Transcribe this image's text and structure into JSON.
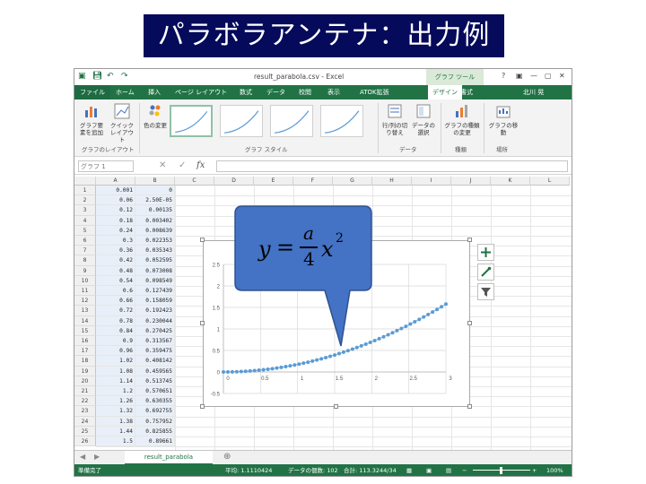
{
  "slide_title": "パラボラアンテナ：出力例",
  "excel": {
    "window_title": "result_parabola.csv - Excel",
    "context_tab": "グラフ ツール",
    "window_controls": [
      "?",
      "▣",
      "—",
      "▢",
      "✕"
    ],
    "tabs": [
      "ファイル",
      "ホーム",
      "挿入",
      "ページ レイアウト",
      "数式",
      "データ",
      "校閲",
      "表示",
      "ATOK拡張",
      "デザイン",
      "書式"
    ],
    "active_tab": "デザイン",
    "user": "北川 晃",
    "ribbon": {
      "buttons": [
        "グラフ要素を追加",
        "クイック レイアウト",
        "色の変更",
        "行/列の切り替え",
        "データの選択",
        "グラフの種類の変更",
        "グラフの移動"
      ],
      "groups": [
        "グラフのレイアウト",
        "グラフ スタイル",
        "データ",
        "種類",
        "場所"
      ]
    },
    "formula_bar": {
      "name_box": "グラフ 1",
      "fx": "fx"
    },
    "columns": [
      "A",
      "B",
      "C",
      "D",
      "E",
      "F",
      "G",
      "H",
      "I",
      "J",
      "K",
      "L"
    ],
    "rows": [
      "1",
      "2",
      "3",
      "4",
      "5",
      "6",
      "7",
      "8",
      "9",
      "10",
      "11",
      "12",
      "13",
      "14",
      "15",
      "16",
      "17",
      "18",
      "19",
      "20",
      "21",
      "22",
      "23",
      "24",
      "25",
      "26"
    ],
    "col_a": [
      "0.001",
      "0.06",
      "0.12",
      "0.18",
      "0.24",
      "0.3",
      "0.36",
      "0.42",
      "0.48",
      "0.54",
      "0.6",
      "0.66",
      "0.72",
      "0.78",
      "0.84",
      "0.9",
      "0.96",
      "1.02",
      "1.08",
      "1.14",
      "1.2",
      "1.26",
      "1.32",
      "1.38",
      "1.44",
      "1.5"
    ],
    "col_b": [
      "0",
      "2.50E-05",
      "0.00135",
      "0.003402",
      "0.008639",
      "0.022353",
      "0.035343",
      "0.052595",
      "0.073008",
      "0.098549",
      "0.127439",
      "0.158059",
      "0.192423",
      "0.230044",
      "0.270425",
      "0.313567",
      "0.359475",
      "0.408142",
      "0.459565",
      "0.513745",
      "0.570651",
      "0.630355",
      "0.692755",
      "0.757952",
      "0.825855",
      "0.89661"
    ],
    "sheet_tab": "result_parabola",
    "status": {
      "ready": "準備完了",
      "average": "平均: 1.1110424",
      "count": "データの個数: 102",
      "sum": "合計: 113.3244/34",
      "zoom": "100%"
    }
  },
  "callout": {
    "formula_lhs": "y",
    "equals": "=",
    "numerator": "a",
    "denominator": "4",
    "variable": "x",
    "exponent": "2"
  },
  "chart_data": {
    "type": "scatter",
    "title": "",
    "xlabel": "",
    "ylabel": "",
    "xlim": [
      0,
      3
    ],
    "ylim": [
      -0.5,
      2.5
    ],
    "xticks": [
      "0",
      "0.5",
      "1",
      "1.5",
      "2",
      "2.5",
      "3"
    ],
    "yticks": [
      "-0.5",
      "0",
      "0.5",
      "1",
      "1.5",
      "2",
      "2.5"
    ],
    "grid": true,
    "legend": "none",
    "color": "#5b9bd5",
    "x": [
      0,
      0.06,
      0.12,
      0.18,
      0.24,
      0.3,
      0.36,
      0.42,
      0.48,
      0.54,
      0.6,
      0.66,
      0.72,
      0.78,
      0.84,
      0.9,
      0.96,
      1.02,
      1.08,
      1.14,
      1.2,
      1.26,
      1.32,
      1.38,
      1.44,
      1.5,
      1.56,
      1.62,
      1.68,
      1.74,
      1.8,
      1.86,
      1.92,
      1.98,
      2.04,
      2.1,
      2.16,
      2.22,
      2.28,
      2.34,
      2.4,
      2.46,
      2.52,
      2.58,
      2.64,
      2.7,
      2.76,
      2.82,
      2.88,
      2.94,
      3.0
    ],
    "y": [
      0,
      0.0006,
      0.0025,
      0.0057,
      0.0101,
      0.0158,
      0.0227,
      0.0309,
      0.0404,
      0.0511,
      0.0631,
      0.0763,
      0.0909,
      0.1066,
      0.1237,
      0.142,
      0.1616,
      0.1824,
      0.2045,
      0.2278,
      0.2525,
      0.2783,
      0.3055,
      0.3339,
      0.3636,
      0.3945,
      0.4267,
      0.4601,
      0.4949,
      0.5308,
      0.568,
      0.6066,
      0.6463,
      0.6874,
      0.7296,
      0.7732,
      0.818,
      0.8641,
      0.9114,
      0.96,
      1.0099,
      1.061,
      1.1134,
      1.167,
      1.2219,
      1.2781,
      1.3355,
      1.3942,
      1.4541,
      1.5153,
      1.578
    ]
  }
}
